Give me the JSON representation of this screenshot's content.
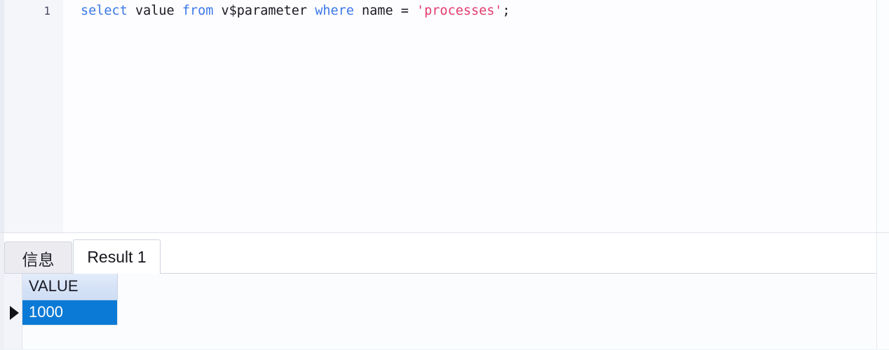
{
  "editor": {
    "line_numbers": [
      "1"
    ],
    "code_tokens": [
      {
        "text": "select",
        "kind": "keyword"
      },
      {
        "text": " ",
        "kind": "plain"
      },
      {
        "text": "value",
        "kind": "plain"
      },
      {
        "text": " ",
        "kind": "plain"
      },
      {
        "text": "from",
        "kind": "keyword"
      },
      {
        "text": " ",
        "kind": "plain"
      },
      {
        "text": "v$parameter",
        "kind": "plain"
      },
      {
        "text": " ",
        "kind": "plain"
      },
      {
        "text": "where",
        "kind": "keyword"
      },
      {
        "text": " ",
        "kind": "plain"
      },
      {
        "text": "name",
        "kind": "plain"
      },
      {
        "text": " ",
        "kind": "plain"
      },
      {
        "text": "=",
        "kind": "plain"
      },
      {
        "text": " ",
        "kind": "plain"
      },
      {
        "text": "'processes'",
        "kind": "string"
      },
      {
        "text": ";",
        "kind": "punct"
      }
    ],
    "full_statement": "select value from v$parameter where name = 'processes';",
    "colors": {
      "keyword": "#3b78e7",
      "plain": "#191923",
      "string": "#e33b6e",
      "line_number": "#4b4a63",
      "background": "#fdfdff",
      "gutter_background": "#f5f6fa"
    }
  },
  "results": {
    "tabs": [
      {
        "label": "信息",
        "active": false
      },
      {
        "label": "Result 1",
        "active": true
      }
    ],
    "grid": {
      "columns": [
        "VALUE"
      ],
      "rows": [
        {
          "cells": [
            "1000"
          ],
          "current": true
        }
      ],
      "selected_cell": {
        "row": 0,
        "column": "VALUE",
        "value": "1000"
      }
    },
    "colors": {
      "header_background": "#d5e2f6",
      "selection_background": "#0b7ad6",
      "selection_text": "#ffffff",
      "tab_active_background": "#ffffff",
      "tab_inactive_background": "#ececf0"
    }
  }
}
